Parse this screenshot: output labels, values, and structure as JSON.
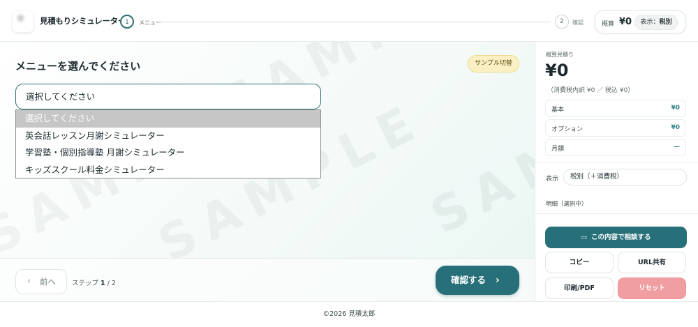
{
  "header": {
    "app_title": "見積もりシミュレーター",
    "steps": [
      {
        "number": "1",
        "label": "メニュー"
      },
      {
        "number": "2",
        "label": "確認"
      }
    ],
    "summary_label": "概算",
    "summary_value": "¥0",
    "display_toggle": {
      "prefix": "表示：",
      "value": "税別"
    }
  },
  "main": {
    "section_title": "メニューを選んでください",
    "sample_button": "サンプル切替",
    "watermark": "SAMPLE",
    "select": {
      "value": "選択してください",
      "options": [
        "選択してください",
        "英会話レッスン月謝シミュレーター",
        "学習塾・個別指導塾 月謝シミュレーター",
        "キッズスクール料金シミュレーター"
      ]
    },
    "nav": {
      "prev_label": "前へ",
      "step_prefix": "ステップ",
      "step_current": "1",
      "step_total": "/ 2",
      "confirm_label": "確認する"
    }
  },
  "sidebar": {
    "caption": "概算見積り",
    "total": "¥0",
    "tax_note": "（消費税内訳 ¥0 ／ 税込 ¥0）",
    "rows": [
      {
        "label": "基本",
        "value": "¥0"
      },
      {
        "label": "オプション",
        "value": "¥0"
      },
      {
        "label": "月額",
        "value": "—"
      }
    ],
    "display_label": "表示",
    "display_value": "税別（＋消費税）",
    "detail_label": "明細（選択中）",
    "consult_label": "この内容で相談する",
    "copy_label": "コピー",
    "url_label": "URL共有",
    "print_label": "印刷/PDF",
    "reset_label": "リセット"
  },
  "footer": {
    "copyright": "©2026 見積太郎"
  },
  "colors": {
    "accent": "#27707a",
    "sample_bg": "#fbf0c3",
    "reset_bg": "#f09ea1",
    "value_text": "#2f7f86"
  },
  "icons": {
    "prev": "chevron-left-icon",
    "confirm": "chevron-right-icon",
    "consult": "chat-bubble-icon"
  }
}
